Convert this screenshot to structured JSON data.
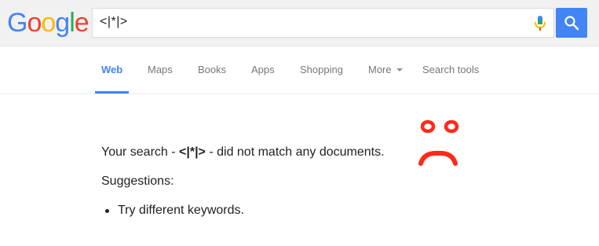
{
  "logo": {
    "letters": [
      {
        "char": "G",
        "color": "#4285f4"
      },
      {
        "char": "o",
        "color": "#ea4335"
      },
      {
        "char": "o",
        "color": "#fbbc05"
      },
      {
        "char": "g",
        "color": "#4285f4"
      },
      {
        "char": "l",
        "color": "#34a853"
      },
      {
        "char": "e",
        "color": "#ea4335"
      }
    ]
  },
  "search": {
    "query": "<|*|>",
    "button_color": "#4285f4"
  },
  "nav": {
    "tabs": [
      {
        "label": "Web",
        "active": true
      },
      {
        "label": "Maps",
        "active": false
      },
      {
        "label": "Books",
        "active": false
      },
      {
        "label": "Apps",
        "active": false
      },
      {
        "label": "Shopping",
        "active": false
      },
      {
        "label": "More",
        "active": false
      },
      {
        "label": "Search tools",
        "active": false
      }
    ]
  },
  "results": {
    "message_prefix": "Your search - ",
    "message_query": "<|*|>",
    "message_suffix": " - did not match any documents.",
    "suggestions_heading": "Suggestions:",
    "suggestions": [
      "Try different keywords."
    ]
  },
  "annotation": {
    "icon": "sad-face-icon",
    "color": "#ff2a1a"
  }
}
